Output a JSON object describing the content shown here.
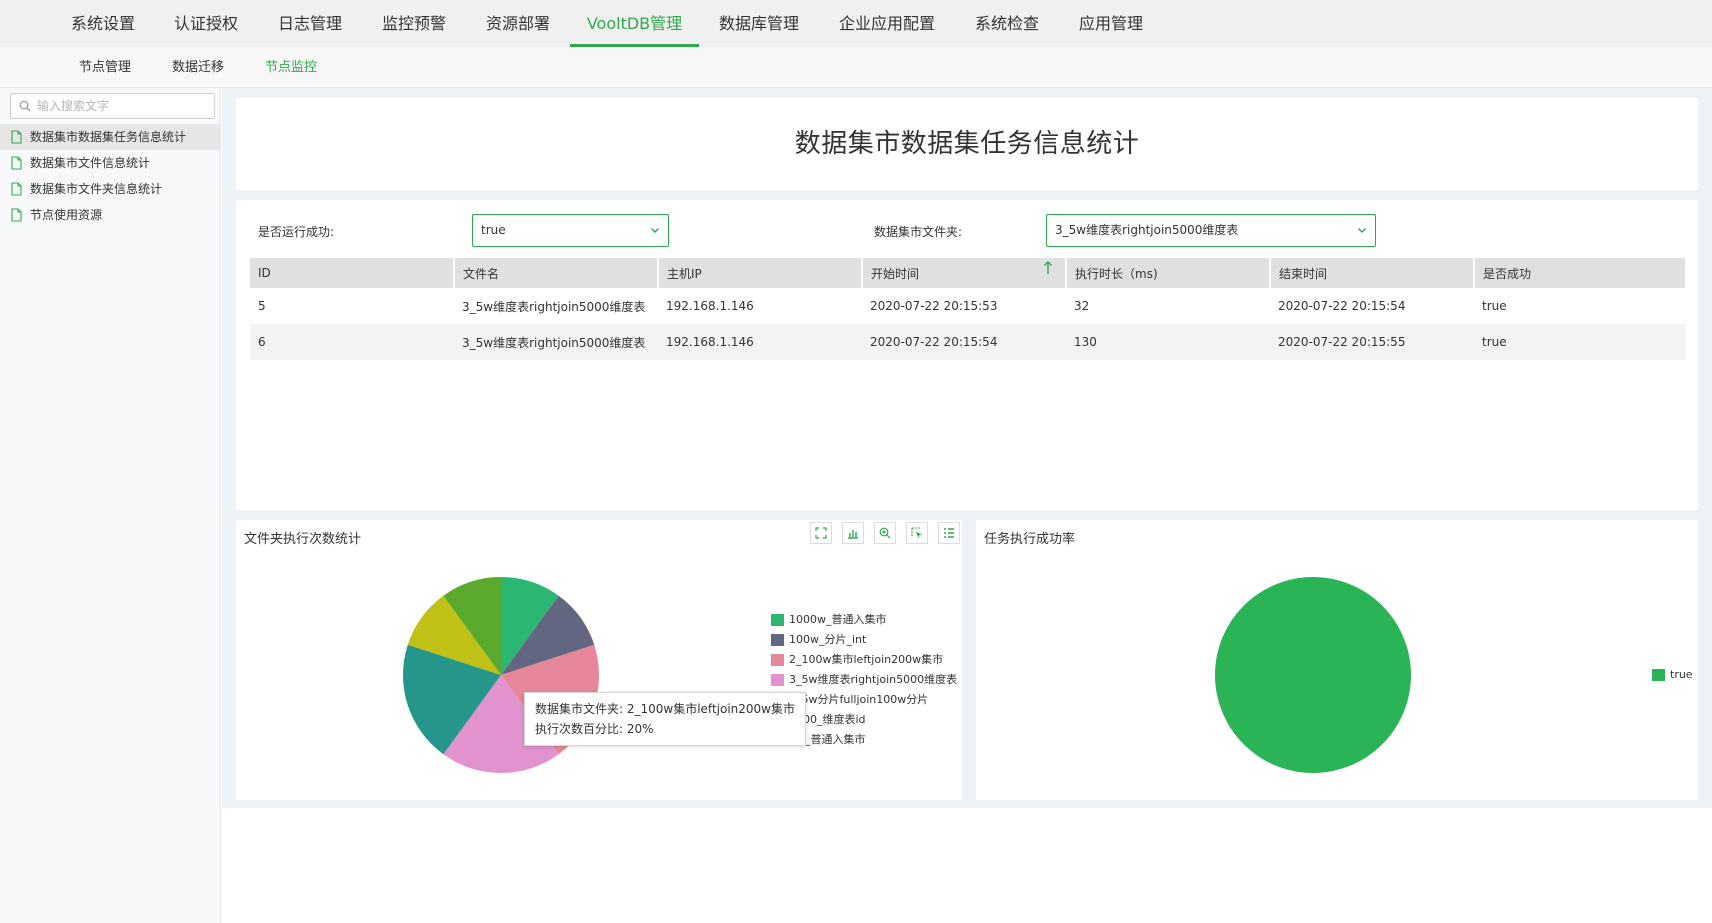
{
  "top_nav": {
    "items": [
      {
        "label": "系统设置"
      },
      {
        "label": "认证授权"
      },
      {
        "label": "日志管理"
      },
      {
        "label": "监控预警"
      },
      {
        "label": "资源部署"
      },
      {
        "label": "VooltDB管理"
      },
      {
        "label": "数据库管理"
      },
      {
        "label": "企业应用配置"
      },
      {
        "label": "系统检查"
      },
      {
        "label": "应用管理"
      }
    ],
    "active_index": 5
  },
  "sub_nav": {
    "items": [
      {
        "label": "节点管理"
      },
      {
        "label": "数据迁移"
      },
      {
        "label": "节点监控"
      }
    ],
    "active_index": 2
  },
  "sidebar": {
    "search_placeholder": "输入搜索文字",
    "items": [
      {
        "label": "数据集市数据集任务信息统计"
      },
      {
        "label": "数据集市文件信息统计"
      },
      {
        "label": "数据集市文件夹信息统计"
      },
      {
        "label": "节点使用资源"
      }
    ],
    "active_index": 0
  },
  "page": {
    "title": "数据集市数据集任务信息统计"
  },
  "filters": {
    "success_label": "是否运行成功:",
    "success_value": "true",
    "folder_label": "数据集市文件夹:",
    "folder_value": "3_5w维度表rightjoin5000维度表"
  },
  "table": {
    "columns": [
      "ID",
      "文件名",
      "主机IP",
      "开始时间",
      "执行时长（ms)",
      "结束时间",
      "是否成功"
    ],
    "rows": [
      [
        "5",
        "3_5w维度表rightjoin5000维度表",
        "192.168.1.146",
        "2020-07-22 20:15:53",
        "32",
        "2020-07-22 20:15:54",
        "true"
      ],
      [
        "6",
        "3_5w维度表rightjoin5000维度表",
        "192.168.1.146",
        "2020-07-22 20:15:54",
        "130",
        "2020-07-22 20:15:55",
        "true"
      ]
    ]
  },
  "charts": {
    "folder_title": "文件夹执行次数统计",
    "success_title": "任务执行成功率",
    "tooltip": {
      "line1": "数据集市文件夹: 2_100w集市leftjoin200w集市",
      "line2": "执行次数百分比: 20%"
    }
  },
  "chart_data": [
    {
      "type": "pie",
      "title": "文件夹执行次数统计",
      "categories": [
        "1000w_普通入集市",
        "100w_分片_int",
        "2_100w集市leftjoin200w集市",
        "3_5w维度表rightjoin5000维度表",
        "4_5w分片fulljoin100w分片",
        "5000_维度表id",
        "5w_普通入集市"
      ],
      "values": [
        10,
        10,
        20,
        20,
        20,
        10,
        10
      ],
      "colors": [
        "#2bb673",
        "#626681",
        "#e5869b",
        "#e293cd",
        "#26968b",
        "#bfc116",
        "#5ba92c"
      ],
      "legend": "right"
    },
    {
      "type": "pie",
      "title": "任务执行成功率",
      "categories": [
        "true"
      ],
      "values": [
        100
      ],
      "colors": [
        "#2bb455"
      ],
      "legend": "right"
    }
  ],
  "colors": {
    "accent": "#2fa84f"
  }
}
